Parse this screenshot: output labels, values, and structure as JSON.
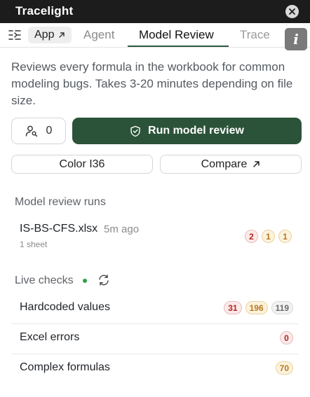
{
  "window": {
    "title": "Tracelight"
  },
  "tabs": {
    "app_label": "App",
    "agent_label": "Agent",
    "model_review_label": "Model Review",
    "trace_label": "Trace",
    "active": "Model Review"
  },
  "info_label": "i",
  "description": "Reviews every formula in the workbook for common modeling bugs. Takes 3-20 minutes depending on file size.",
  "actions": {
    "user_count": "0",
    "run_label": "Run model review",
    "color_label": "Color I36",
    "compare_label": "Compare"
  },
  "runs": {
    "heading": "Model review runs",
    "items": [
      {
        "file": "IS-BS-CFS.xlsx",
        "time": "5m ago",
        "sub": "1 sheet",
        "badges": [
          "2",
          "1",
          "1"
        ]
      }
    ]
  },
  "live": {
    "heading": "Live checks",
    "items": [
      {
        "label": "Hardcoded values",
        "badges": [
          "31",
          "196",
          "119"
        ]
      },
      {
        "label": "Excel errors",
        "badges": [
          "0"
        ]
      },
      {
        "label": "Complex formulas",
        "badges": [
          "70"
        ]
      }
    ]
  },
  "colors": {
    "accent": "#2b5339",
    "badge_red": "#b3261e",
    "badge_yellow": "#b7791f",
    "badge_gray": "#6b6b6b",
    "live_dot": "#2ea043"
  },
  "icons": {
    "close": "close-icon",
    "sidebar_toggle": "sidebar-toggle-icon",
    "external": "arrow-up-right-icon",
    "user": "user-search-icon",
    "shield": "shield-check-icon",
    "refresh": "refresh-icon",
    "info": "info-icon"
  }
}
